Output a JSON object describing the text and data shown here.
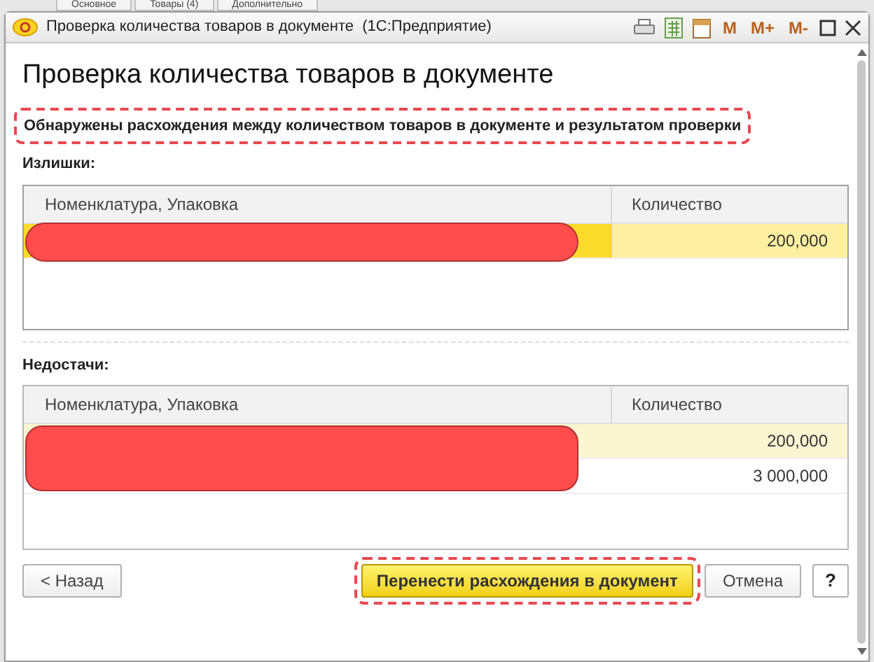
{
  "background_tabs": [
    {
      "label": "Основное"
    },
    {
      "label": "Товары (4)"
    },
    {
      "label": "Дополнительно"
    }
  ],
  "window": {
    "title": "Проверка количества товаров в документе  (1С:Предприятие)",
    "toolbar": [
      "M",
      "M+",
      "M-"
    ]
  },
  "heading": "Проверка количества товаров в документе",
  "message": "Обнаружены расхождения между количеством товаров в документе и результатом проверки",
  "sections": [
    {
      "label": "Излишки:",
      "columns": [
        "Номенклатура, Упаковка",
        "Количество"
      ],
      "focused": true,
      "rows": [
        {
          "quantity": "200,000",
          "selected": true
        }
      ]
    },
    {
      "label": "Недостачи:",
      "columns": [
        "Номенклатура, Упаковка",
        "Количество"
      ],
      "focused": false,
      "rows": [
        {
          "quantity": "200,000",
          "selected": true
        },
        {
          "quantity": "3 000,000",
          "selected": false
        }
      ]
    }
  ],
  "buttons": [
    {
      "label": "< Назад",
      "kind": "plain"
    },
    {
      "label": "Перенести расхождения в документ",
      "kind": "primary"
    },
    {
      "label": "Отмена",
      "kind": "plain"
    },
    {
      "label": "?",
      "kind": "help"
    }
  ]
}
